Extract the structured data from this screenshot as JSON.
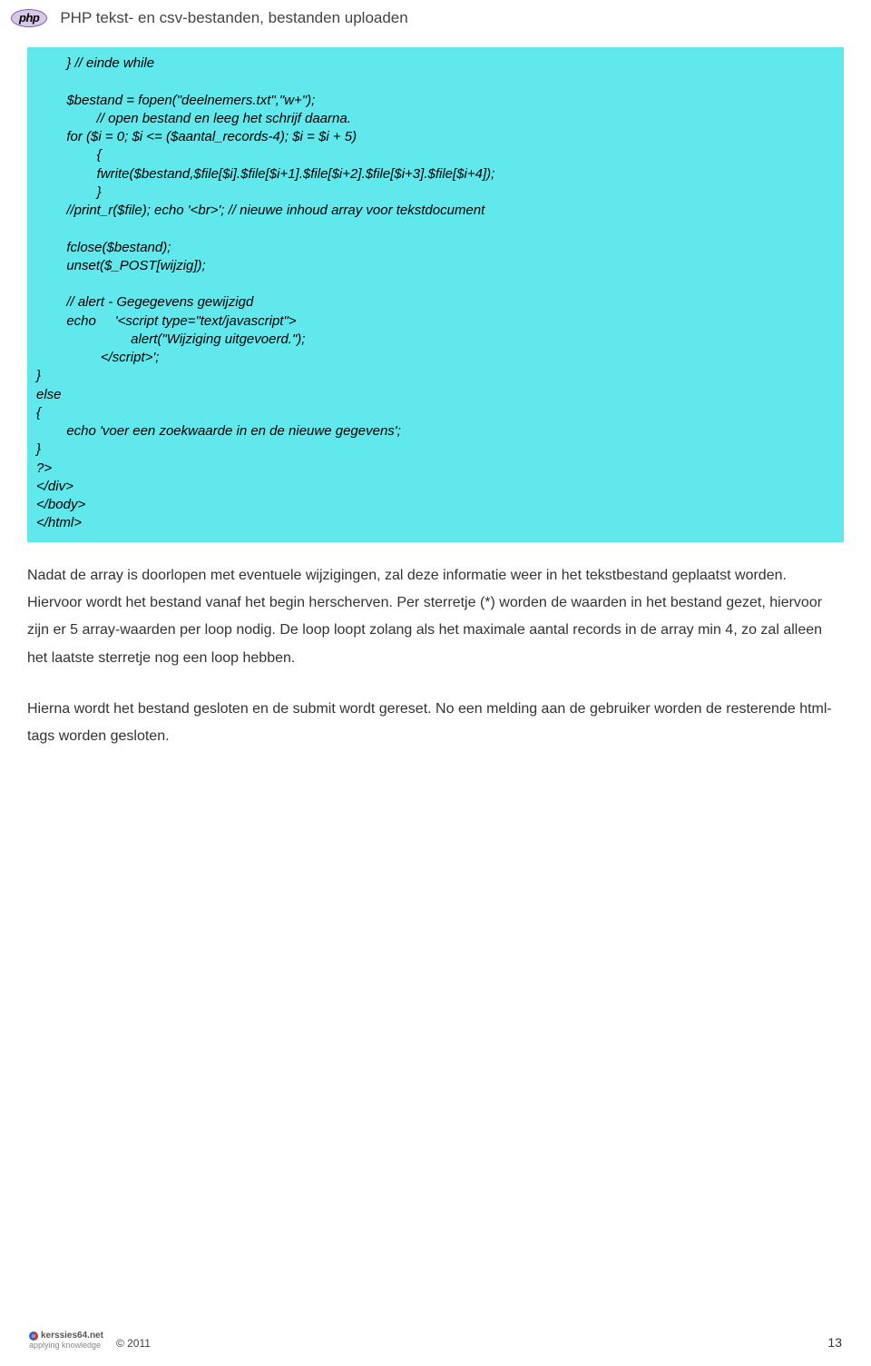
{
  "header": {
    "badge": "php",
    "title": "PHP tekst- en csv-bestanden, bestanden uploaden"
  },
  "code": "        } // einde while\n\n        $bestand = fopen(\"deelnemers.txt\",\"w+\");\n                // open bestand en leeg het schrijf daarna.\n        for ($i = 0; $i <= ($aantal_records-4); $i = $i + 5)\n                {\n                fwrite($bestand,$file[$i].$file[$i+1].$file[$i+2].$file[$i+3].$file[$i+4]);\n                }\n        //print_r($file); echo '<br>'; // nieuwe inhoud array voor tekstdocument\n\n        fclose($bestand);\n        unset($_POST[wijzig]);\n\n        // alert - Gegegevens gewijzigd\n        echo     '<script type=\"text/javascript\">\n                         alert(\"Wijziging uitgevoerd.\");\n                 </script>';\n}\nelse\n{\n        echo 'voer een zoekwaarde in en de nieuwe gegevens';\n}\n?>\n</div>\n</body>\n</html>",
  "paragraphs": {
    "p1": "Nadat de array is doorlopen met eventuele wijzigingen, zal deze informatie weer in het tekstbestand geplaatst worden. Hiervoor wordt het bestand vanaf het begin herscherven. Per sterretje (*) worden de waarden in het bestand gezet, hiervoor zijn er 5 array-waarden per loop nodig. De loop loopt zolang als het maximale aantal records in de array min 4, zo zal alleen het laatste sterretje nog een loop hebben.",
    "p2": "Hierna wordt het bestand gesloten en de submit wordt gereset. No een melding aan de gebruiker worden de resterende html-tags worden gesloten."
  },
  "footer": {
    "brand": "kerssies64.net",
    "tagline": "applying knowledge",
    "year": "© 2011",
    "page": "13"
  }
}
